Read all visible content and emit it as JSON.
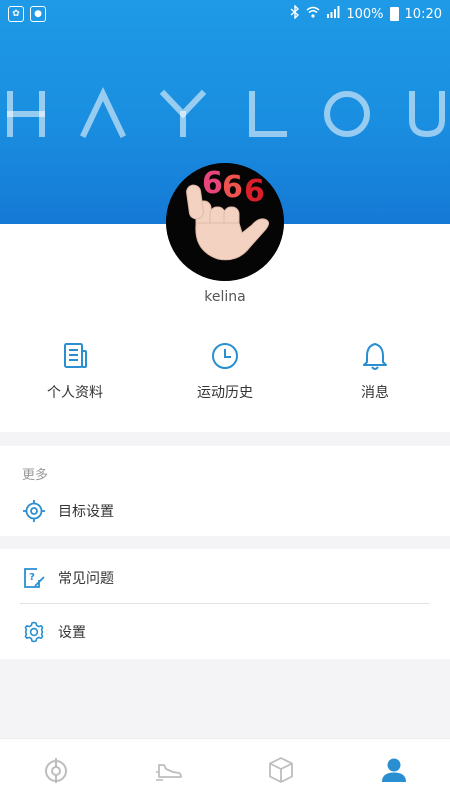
{
  "status_bar": {
    "battery": "100%",
    "time": "10:20"
  },
  "brand": {
    "text": "HAYLOU"
  },
  "profile": {
    "avatar_text": "666",
    "username": "kelina"
  },
  "quick_actions": [
    {
      "label": "个人资料",
      "icon": "profile-doc-icon"
    },
    {
      "label": "运动历史",
      "icon": "clock-icon"
    },
    {
      "label": "消息",
      "icon": "bell-icon"
    }
  ],
  "more_section": {
    "title": "更多",
    "goal_label": "目标设置"
  },
  "help_section": {
    "faq_label": "常见问题",
    "settings_label": "设置"
  },
  "bottom_nav": [
    {
      "icon": "watch-dial-icon",
      "active": false
    },
    {
      "icon": "sneaker-icon",
      "active": false
    },
    {
      "icon": "box-icon",
      "active": false
    },
    {
      "icon": "user-icon",
      "active": true
    }
  ],
  "colors": {
    "accent": "#2a8fd0",
    "header_top": "#1e9ae6",
    "header_bottom": "#1579d5",
    "inactive_icon": "#bdbdbd"
  }
}
